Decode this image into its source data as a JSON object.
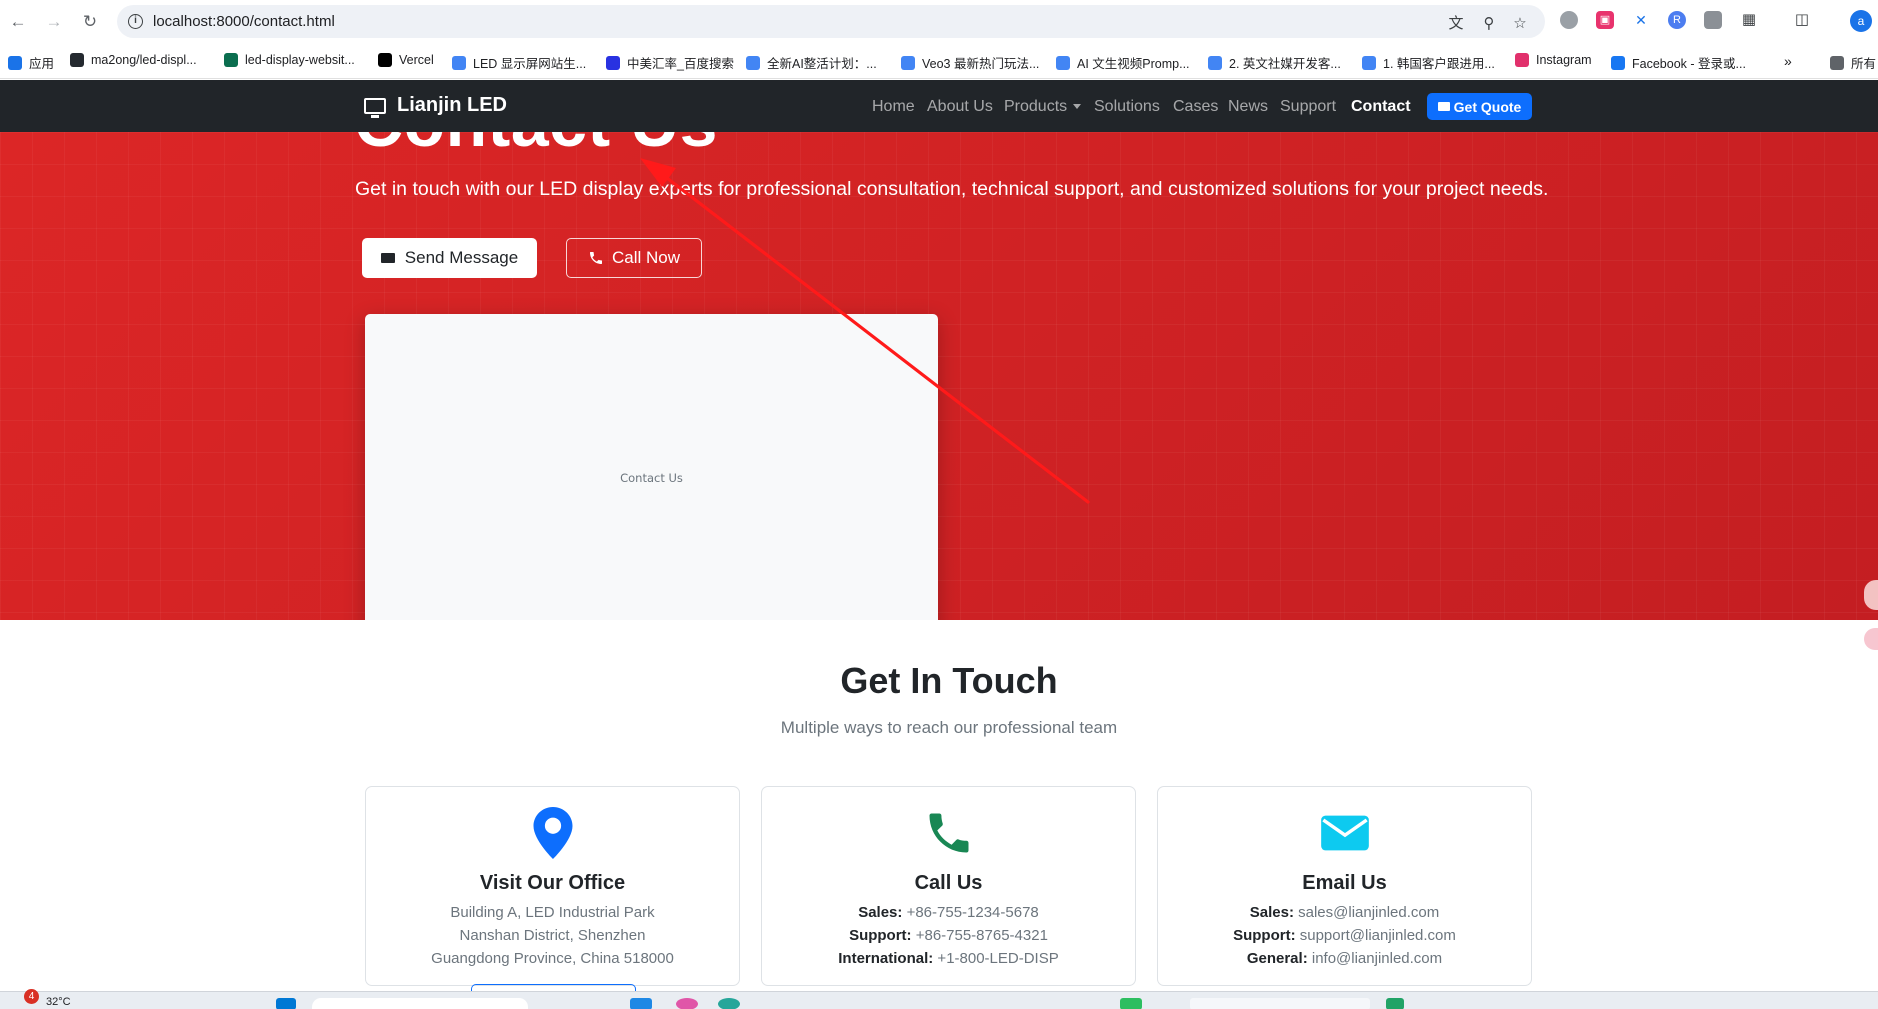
{
  "browser": {
    "url": "localhost:8000/contact.html",
    "bookmarks": [
      {
        "label": "应用",
        "color": "#1a73e8"
      },
      {
        "label": "ma2ong/led-displ...",
        "color": "#24292f"
      },
      {
        "label": "led-display-websit...",
        "color": "#0b6e4f"
      },
      {
        "label": "Vercel",
        "color": "#000000"
      },
      {
        "label": "LED 显示屏网站生...",
        "color": "#4285f4"
      },
      {
        "label": "中美汇率_百度搜索",
        "color": "#2932e1"
      },
      {
        "label": "全新AI整活计划：...",
        "color": "#4285f4"
      },
      {
        "label": "Veo3 最新热门玩法...",
        "color": "#4285f4"
      },
      {
        "label": "AI 文生视频Promp...",
        "color": "#4285f4"
      },
      {
        "label": "2. 英文社媒开发客...",
        "color": "#4285f4"
      },
      {
        "label": "1. 韩国客户跟进用...",
        "color": "#4285f4"
      },
      {
        "label": "Instagram",
        "color": "#e1306c"
      },
      {
        "label": "Facebook - 登录或...",
        "color": "#1877f2"
      },
      {
        "label": "所有",
        "color": "#5f6368"
      }
    ],
    "profile_initial": "a"
  },
  "nav": {
    "brand": "Lianjin LED",
    "links": [
      "Home",
      "About Us",
      "Products",
      "Solutions",
      "Cases",
      "News",
      "Support",
      "Contact"
    ],
    "active": "Contact",
    "quote_label": "Get Quote"
  },
  "hero": {
    "title": "Contact Us",
    "subtitle": "Get in touch with our LED display experts for professional consultation, technical support, and customized solutions for your project needs.",
    "send_label": "Send Message",
    "call_label": "Call Now",
    "image_alt": "Contact Us"
  },
  "touch": {
    "title": "Get In Touch",
    "subtitle": "Multiple ways to reach our professional team",
    "cards": [
      {
        "title": "Visit Our Office",
        "icon": "map-pin-icon",
        "color": "#0d6efd",
        "lines": [
          {
            "k": "",
            "v": "Building A, LED Industrial Park"
          },
          {
            "k": "",
            "v": "Nanshan District, Shenzhen"
          },
          {
            "k": "",
            "v": "Guangdong Province, China 518000"
          }
        ]
      },
      {
        "title": "Call Us",
        "icon": "phone-icon",
        "color": "#198754",
        "lines": [
          {
            "k": "Sales:",
            "v": " +86-755-1234-5678"
          },
          {
            "k": "Support:",
            "v": " +86-755-8765-4321"
          },
          {
            "k": "International:",
            "v": " +1-800-LED-DISP"
          }
        ]
      },
      {
        "title": "Email Us",
        "icon": "envelope-icon",
        "color": "#0dcaf0",
        "lines": [
          {
            "k": "Sales:",
            "v": " sales@lianjinled.com"
          },
          {
            "k": "Support:",
            "v": " support@lianjinled.com"
          },
          {
            "k": "General:",
            "v": " info@lianjinled.com"
          }
        ]
      }
    ]
  },
  "taskbar": {
    "weather": "32°C",
    "badge": "4"
  },
  "colors": {
    "hero_red": "#d32123",
    "navbar": "#212529",
    "primary": "#0d6efd",
    "annotation": "#ff1a1a"
  }
}
